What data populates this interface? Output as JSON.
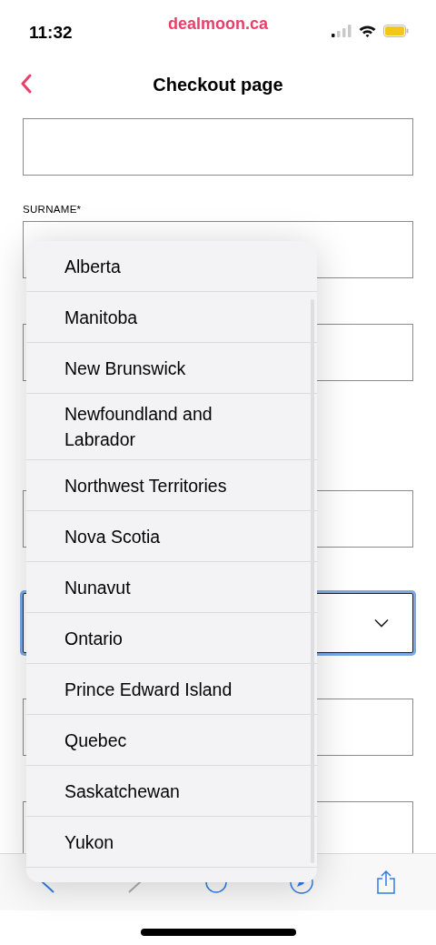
{
  "status_bar": {
    "time": "11:32",
    "site": "dealmoon.ca"
  },
  "nav": {
    "title": "Checkout page"
  },
  "form": {
    "fields": [
      {
        "kind": "text",
        "focused": false
      },
      {
        "kind": "text",
        "label": "SURNAME*",
        "focused": false
      },
      {
        "kind": "text",
        "focused": false
      },
      {
        "kind": "text",
        "focused": false
      },
      {
        "kind": "select",
        "focused": true
      },
      {
        "kind": "text",
        "focused": false
      },
      {
        "kind": "text",
        "focused": false
      }
    ]
  },
  "dropdown": {
    "options": [
      {
        "label": "Alberta"
      },
      {
        "label": "Manitoba"
      },
      {
        "label": "New Brunswick"
      },
      {
        "label": "Newfoundland and Labrador"
      },
      {
        "label": "Northwest Territories"
      },
      {
        "label": "Nova Scotia"
      },
      {
        "label": "Nunavut"
      },
      {
        "label": "Ontario"
      },
      {
        "label": "Prince Edward Island"
      },
      {
        "label": "Quebec"
      },
      {
        "label": "Saskatchewan"
      },
      {
        "label": "Yukon"
      }
    ]
  }
}
